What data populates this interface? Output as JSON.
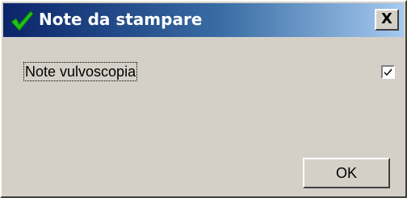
{
  "window": {
    "title": "Note da stampare",
    "close_label": "X",
    "title_icon": "green-checkmark-icon"
  },
  "options": {
    "note_label": "Note vulvoscopia",
    "note_checked": true
  },
  "buttons": {
    "ok_label": "OK"
  },
  "colors": {
    "titlebar_start": "#0a246a",
    "titlebar_end": "#a6caf0",
    "dialog_background": "#d4d0c8",
    "check_icon": "#22c01a"
  }
}
